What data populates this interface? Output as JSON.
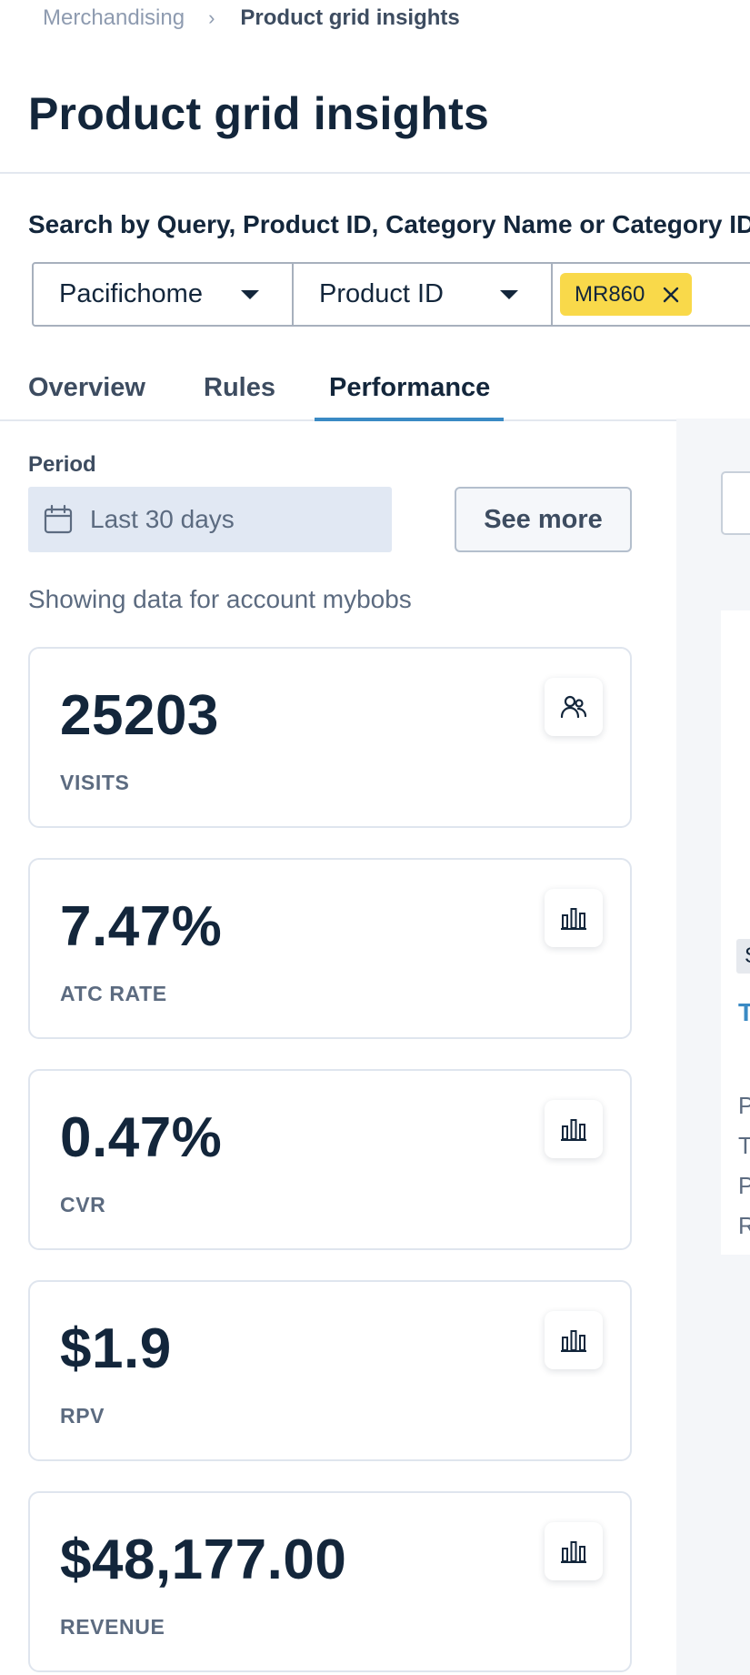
{
  "breadcrumb": {
    "parent": "Merchandising",
    "separator": "›",
    "current": "Product grid insights"
  },
  "page": {
    "title": "Product grid insights"
  },
  "search": {
    "label": "Search by Query, Product ID, Category Name or Category ID",
    "site_select": "Pacifichome",
    "type_select": "Product ID",
    "tag": "MR860"
  },
  "tabs": [
    {
      "label": "Overview",
      "active": false
    },
    {
      "label": "Rules",
      "active": false
    },
    {
      "label": "Performance",
      "active": true
    }
  ],
  "period": {
    "label": "Period",
    "value": "Last 30 days",
    "icon": "calendar-icon"
  },
  "see_more_label": "See more",
  "account_note": "Showing data for account mybobs",
  "metrics": [
    {
      "value": "25203",
      "label": "VISITS",
      "icon": "users-icon"
    },
    {
      "value": "7.47%",
      "label": "ATC RATE",
      "icon": "bar-chart-icon"
    },
    {
      "value": "0.47%",
      "label": "CVR",
      "icon": "bar-chart-icon"
    },
    {
      "value": "$1.9",
      "label": "RPV",
      "icon": "bar-chart-icon"
    },
    {
      "value": "$48,177.00",
      "label": "REVENUE",
      "icon": "bar-chart-icon"
    }
  ],
  "right_panel": {
    "chip_text": "S",
    "link_text": "T",
    "rows": [
      "P",
      "T",
      "P",
      "R"
    ]
  },
  "colors": {
    "text_primary": "#13263b",
    "text_secondary": "#5c6b80",
    "accent": "#3a8ac4",
    "tag_yellow": "#f9d94a",
    "date_bg": "#e1e8f3",
    "panel_bg": "#f4f6f9"
  }
}
